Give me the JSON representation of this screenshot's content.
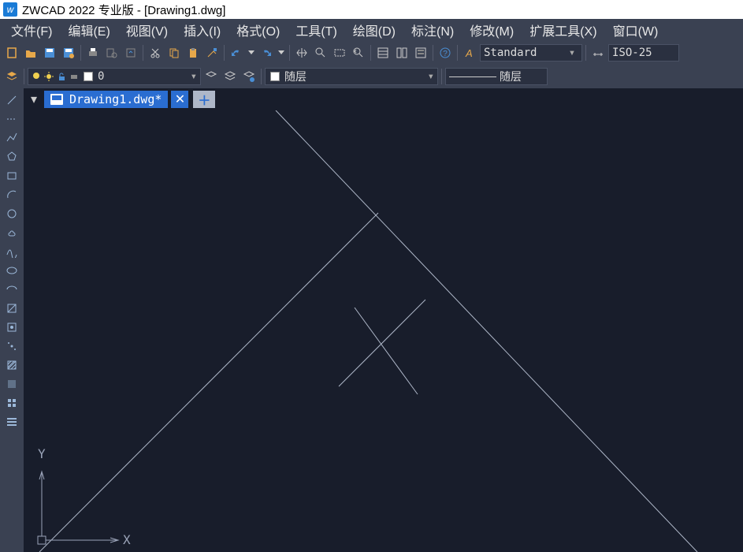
{
  "title": "ZWCAD 2022 专业版 - [Drawing1.dwg]",
  "menubar": {
    "file": "文件(F)",
    "edit": "编辑(E)",
    "view": "视图(V)",
    "insert": "插入(I)",
    "format": "格式(O)",
    "tools": "工具(T)",
    "draw": "绘图(D)",
    "dimension": "标注(N)",
    "modify": "修改(M)",
    "extensions": "扩展工具(X)",
    "window": "窗口(W)"
  },
  "toolbar": {
    "text_style": "Standard",
    "dim_style": "ISO-25"
  },
  "layerbar": {
    "current_layer": "0",
    "linetype_label": "随层",
    "lineweight_label": "随层"
  },
  "tabs": {
    "active": "Drawing1.dwg*"
  },
  "ucs": {
    "x": "X",
    "y": "Y"
  }
}
